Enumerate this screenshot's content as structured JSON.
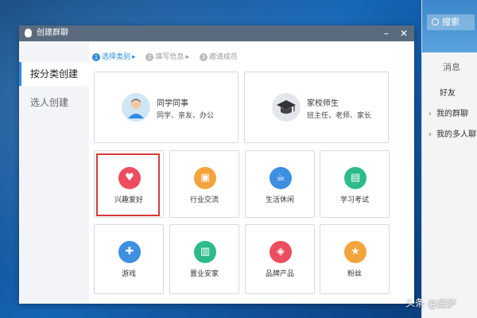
{
  "desktop": {},
  "qq_main": {
    "search_placeholder": "搜索",
    "tab_messages": "消息",
    "section_label": "好友",
    "groups": [
      {
        "label": "我的群聊"
      },
      {
        "label": "我的多人聊"
      }
    ]
  },
  "dialog": {
    "title": "创建群聊",
    "nav": [
      {
        "label": "按分类创建",
        "active": true
      },
      {
        "label": "选人创建",
        "active": false
      }
    ],
    "steps": [
      {
        "num": "1",
        "label": "选择类别",
        "active": true
      },
      {
        "num": "2",
        "label": "填写信息",
        "active": false
      },
      {
        "num": "3",
        "label": "邀请成员",
        "active": false
      }
    ],
    "big_categories": [
      {
        "title": "同学同事",
        "sub": "同学、亲友、办公"
      },
      {
        "title": "家校师生",
        "sub": "班主任、老师、家长"
      }
    ],
    "categories": [
      {
        "label": "兴趣爱好",
        "color": "#ec4d5f",
        "icon": "heart-icon",
        "glyph": "♥"
      },
      {
        "label": "行业交流",
        "color": "#f3a33c",
        "icon": "briefcase-icon",
        "glyph": "▣"
      },
      {
        "label": "生活休闲",
        "color": "#3d8fe0",
        "icon": "coffee-cup-icon",
        "glyph": "☕"
      },
      {
        "label": "学习考试",
        "color": "#2dbb8a",
        "icon": "notebook-icon",
        "glyph": "▤"
      },
      {
        "label": "游戏",
        "color": "#3d8fe0",
        "icon": "gamepad-icon",
        "glyph": "✚"
      },
      {
        "label": "置业安家",
        "color": "#2dbb8a",
        "icon": "building-icon",
        "glyph": "▥"
      },
      {
        "label": "品牌产品",
        "color": "#ec4d5f",
        "icon": "tag-icon",
        "glyph": "◈"
      },
      {
        "label": "粉丝",
        "color": "#f3a33c",
        "icon": "star-icon",
        "glyph": "★"
      }
    ]
  },
  "watermark": "头条 @屁萨"
}
